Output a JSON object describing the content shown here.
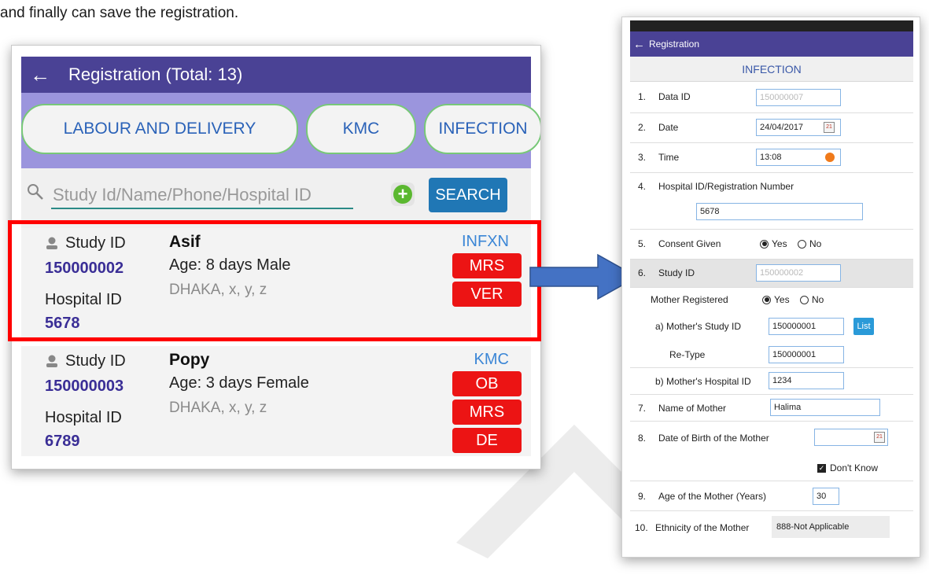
{
  "caption": "and finally can save the registration.",
  "colors": {
    "appbar": "#4a4295",
    "tabs_bg": "#9b95dd",
    "badge_red": "#ec1414",
    "highlight": "#ff0000",
    "search_button": "#2077b5",
    "arrow": "#4472c4",
    "type_blue": "#3b86d6"
  },
  "left": {
    "header": {
      "back_icon": "arrow-left-icon",
      "title": "Registration  (Total: 13)"
    },
    "tabs": [
      "LABOUR AND DELIVERY",
      "KMC",
      "INFECTION"
    ],
    "search": {
      "icon": "search-icon",
      "placeholder": "Study Id/Name/Phone/Hospital ID",
      "add_icon": "plus-circle-icon",
      "button": "SEARCH"
    },
    "records": [
      {
        "study_label": "Study ID",
        "study_id": "150000002",
        "hospital_label": "Hospital ID",
        "hospital_id": "5678",
        "name": "Asif",
        "age": "Age: 8 days   Male",
        "address": "DHAKA, x, y, z",
        "type": "INFXN",
        "badges": [
          "MRS",
          "VER"
        ]
      },
      {
        "study_label": "Study ID",
        "study_id": "150000003",
        "hospital_label": "Hospital ID",
        "hospital_id": "6789",
        "name": "Popy",
        "age": "Age: 3 days   Female",
        "address": "DHAKA, x, y, z",
        "type": "KMC",
        "badges": [
          "OB",
          "MRS",
          "DE"
        ]
      }
    ]
  },
  "right": {
    "appbar_title": "Registration",
    "section": "INFECTION",
    "fields": {
      "f1": {
        "num": "1.",
        "label": "Data ID",
        "value": "150000007"
      },
      "f2": {
        "num": "2.",
        "label": "Date",
        "value": "24/04/2017"
      },
      "f3": {
        "num": "3.",
        "label": "Time",
        "value": "13:08"
      },
      "f4": {
        "num": "4.",
        "label": "Hospital ID/Registration Number",
        "value": "5678"
      },
      "f5": {
        "num": "5.",
        "label": "Consent Given",
        "yes": "Yes",
        "no": "No"
      },
      "f6": {
        "num": "6.",
        "label": "Study ID",
        "value": "150000002"
      },
      "mother_reg": {
        "label": "Mother Registered",
        "yes": "Yes",
        "no": "No"
      },
      "mother_study": {
        "label": "a) Mother's Study ID",
        "value": "150000001",
        "button": "List"
      },
      "retype": {
        "label": "Re-Type",
        "value": "150000001"
      },
      "mother_hosp": {
        "label": "b) Mother's Hospital ID",
        "value": "1234"
      },
      "f7": {
        "num": "7.",
        "label": "Name of Mother",
        "value": "Halima"
      },
      "f8": {
        "num": "8.",
        "label": "Date of Birth of the Mother",
        "value": ""
      },
      "dont_know": "Don't Know",
      "f9": {
        "num": "9.",
        "label": "Age of the Mother (Years)",
        "value": "30"
      },
      "f10": {
        "num": "10.",
        "label": "Ethnicity of the Mother",
        "value": "888-Not Applicable"
      }
    }
  }
}
